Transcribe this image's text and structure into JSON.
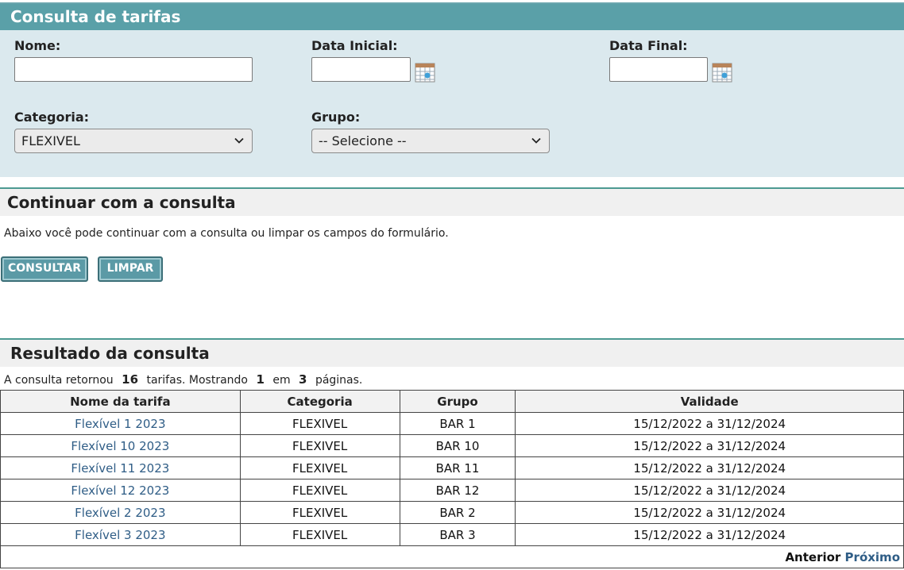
{
  "search": {
    "title": "Consulta de tarifas",
    "nome_label": "Nome:",
    "nome_value": "",
    "data_inicial_label": "Data Inicial:",
    "data_inicial_value": "",
    "data_final_label": "Data Final:",
    "data_final_value": "",
    "categoria_label": "Categoria:",
    "categoria_value": "FLEXIVEL",
    "grupo_label": "Grupo:",
    "grupo_value": "-- Selecione --"
  },
  "continue": {
    "title": "Continuar com a consulta",
    "description": "Abaixo você pode continuar com a consulta ou limpar os campos do formulário.",
    "consultar_label": "CONSULTAR",
    "limpar_label": "LIMPAR"
  },
  "results": {
    "title": "Resultado da consulta",
    "summary_prefix": "A consulta retornou",
    "total": "16",
    "summary_mid": "tarifas. Mostrando",
    "page": "1",
    "summary_em": "em",
    "pages": "3",
    "summary_suffix": "páginas.",
    "columns": [
      "Nome da tarifa",
      "Categoria",
      "Grupo",
      "Validade"
    ],
    "rows": [
      {
        "nome": "Flexível 1 2023",
        "categoria": "FLEXIVEL",
        "grupo": "BAR 1",
        "validade": "15/12/2022 a 31/12/2024"
      },
      {
        "nome": "Flexível 10 2023",
        "categoria": "FLEXIVEL",
        "grupo": "BAR 10",
        "validade": "15/12/2022 a 31/12/2024"
      },
      {
        "nome": "Flexível 11 2023",
        "categoria": "FLEXIVEL",
        "grupo": "BAR 11",
        "validade": "15/12/2022 a 31/12/2024"
      },
      {
        "nome": "Flexível 12 2023",
        "categoria": "FLEXIVEL",
        "grupo": "BAR 12",
        "validade": "15/12/2022 a 31/12/2024"
      },
      {
        "nome": "Flexível 2 2023",
        "categoria": "FLEXIVEL",
        "grupo": "BAR 2",
        "validade": "15/12/2022 a 31/12/2024"
      },
      {
        "nome": "Flexível 3 2023",
        "categoria": "FLEXIVEL",
        "grupo": "BAR 3",
        "validade": "15/12/2022 a 31/12/2024"
      }
    ],
    "pager_prev": "Anterior",
    "pager_next": "Próximo"
  },
  "icons": {
    "calendar": "calendar-icon",
    "dropdown": "chevron-down-icon"
  },
  "colors": {
    "header_bg": "#5aa0a8",
    "panel_bg": "#dbe9ee",
    "link": "#2f5d86",
    "button": "#5b9aa6"
  }
}
